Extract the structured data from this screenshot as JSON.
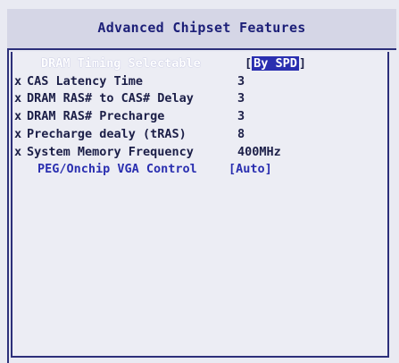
{
  "title": "Advanced Chipset Features",
  "items": [
    {
      "mark": "",
      "label": "DRAM Timing Selectable",
      "value": "By SPD",
      "bracketed": true,
      "state": "highlighted"
    },
    {
      "mark": "x",
      "label": "CAS Latency Time",
      "value": "3",
      "bracketed": false,
      "state": "disabled"
    },
    {
      "mark": "x",
      "label": "DRAM RAS# to CAS# Delay",
      "value": "3",
      "bracketed": false,
      "state": "disabled"
    },
    {
      "mark": "x",
      "label": "DRAM RAS# Precharge",
      "value": "3",
      "bracketed": false,
      "state": "disabled"
    },
    {
      "mark": "x",
      "label": "Precharge dealy (tRAS)",
      "value": "8",
      "bracketed": false,
      "state": "disabled"
    },
    {
      "mark": "x",
      "label": "System Memory Frequency",
      "value": "400MHz",
      "bracketed": false,
      "state": "disabled"
    },
    {
      "mark": "",
      "label": "PEG/Onchip VGA Control",
      "value": "Auto",
      "bracketed": true,
      "state": "editable"
    }
  ],
  "colors": {
    "background": "#e9eaf2",
    "frame": "#2c2f7a",
    "title_text": "#1c1f78",
    "item_text": "#1c1f48",
    "editable_text": "#2a2fb0",
    "selection_bg": "#2a2fb0",
    "selection_text": "#ffffff"
  }
}
